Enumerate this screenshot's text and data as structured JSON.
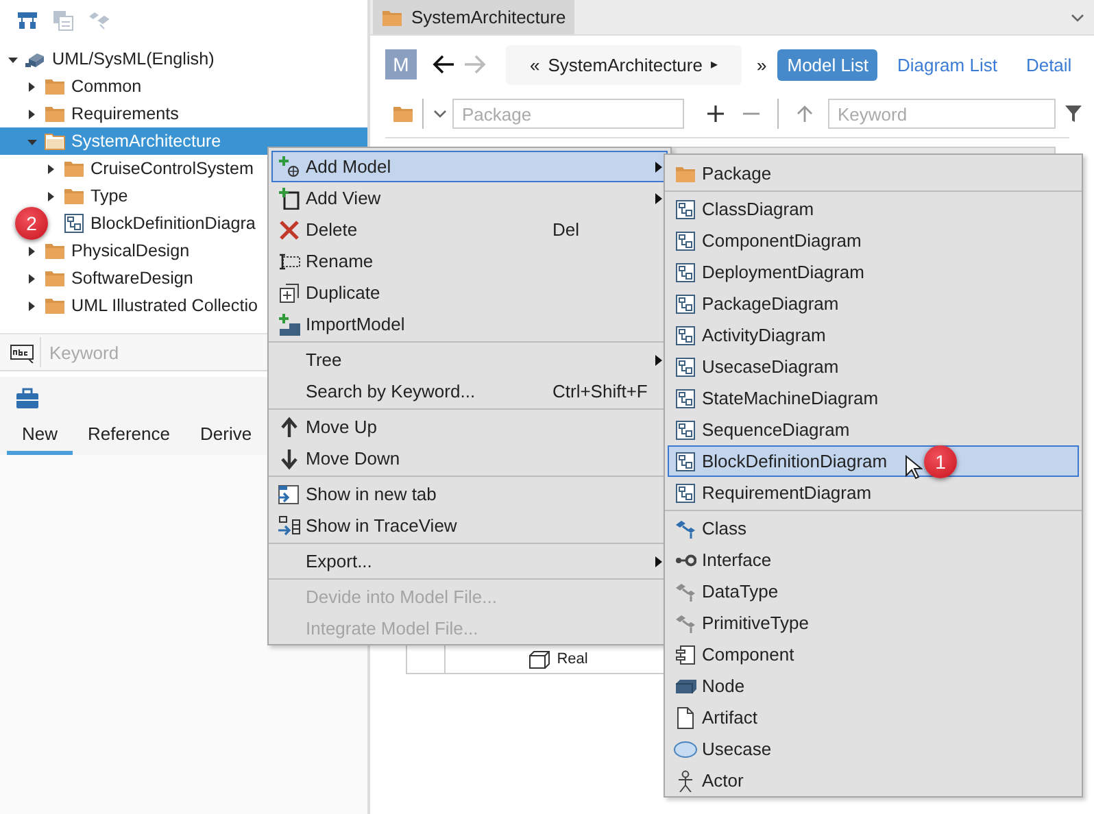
{
  "left_toolbar": [
    {
      "disabled": false
    },
    {
      "disabled": true
    },
    {
      "disabled": true
    }
  ],
  "tree": [
    {
      "label": "UML/SysML(English)",
      "kind": "model",
      "expanded": true,
      "selected": false,
      "children": [
        {
          "label": "Common",
          "kind": "package",
          "expanded": false,
          "selected": false
        },
        {
          "label": "Requirements",
          "kind": "package",
          "expanded": false,
          "selected": false
        },
        {
          "label": "SystemArchitecture",
          "kind": "package",
          "expanded": true,
          "selected": true,
          "children": [
            {
              "label": "CruiseControlSystem",
              "kind": "package",
              "expanded": false,
              "selected": false
            },
            {
              "label": "Type",
              "kind": "package",
              "expanded": false,
              "selected": false
            },
            {
              "label": "BlockDefinitionDiagra",
              "kind": "diagram",
              "selected": false,
              "badge": "2"
            }
          ]
        },
        {
          "label": "PhysicalDesign",
          "kind": "package",
          "expanded": false,
          "selected": false
        },
        {
          "label": "SoftwareDesign",
          "kind": "package",
          "expanded": false,
          "selected": false
        },
        {
          "label": "UML Illustrated Collectio",
          "kind": "package",
          "expanded": false,
          "selected": false
        }
      ]
    }
  ],
  "tree_search": {
    "placeholder": "Keyword"
  },
  "toolbox": {
    "tabs": [
      {
        "label": "New",
        "selected": true
      },
      {
        "label": "Reference",
        "selected": false
      },
      {
        "label": "Derive",
        "selected": false
      }
    ]
  },
  "editor": {
    "tab": "SystemArchitecture",
    "avatar": "M",
    "back": {
      "disabled": false
    },
    "forward": {
      "disabled": true
    },
    "breadcrumb": {
      "prev": "«",
      "label": "SystemArchitecture",
      "next": "▸"
    },
    "more": "»",
    "views": [
      {
        "label": "Model List",
        "selected": true
      },
      {
        "label": "Diagram List",
        "selected": false
      },
      {
        "label": "Detail",
        "selected": false
      }
    ],
    "package_field": {
      "placeholder": "Package"
    },
    "keyword_field": {
      "placeholder": "Keyword"
    },
    "table": {
      "rows": [
        {
          "name": "Real"
        }
      ]
    }
  },
  "context_menu": [
    {
      "kind": "item",
      "label": "Add Model",
      "submenu": true,
      "highlighted": true,
      "disabled": false
    },
    {
      "kind": "item",
      "label": "Add View",
      "submenu": true,
      "highlighted": false,
      "disabled": false
    },
    {
      "kind": "item",
      "label": "Delete",
      "shortcut": "Del",
      "submenu": false,
      "highlighted": false,
      "disabled": false
    },
    {
      "kind": "item",
      "label": "Rename",
      "submenu": false,
      "highlighted": false,
      "disabled": false
    },
    {
      "kind": "item",
      "label": "Duplicate",
      "submenu": false,
      "highlighted": false,
      "disabled": false
    },
    {
      "kind": "item",
      "label": "ImportModel",
      "submenu": false,
      "highlighted": false,
      "disabled": false
    },
    {
      "kind": "separator"
    },
    {
      "kind": "item",
      "label": "Tree",
      "submenu": true,
      "highlighted": false,
      "disabled": false
    },
    {
      "kind": "item",
      "label": "Search by Keyword...",
      "shortcut": "Ctrl+Shift+F",
      "submenu": false,
      "highlighted": false,
      "disabled": false
    },
    {
      "kind": "separator"
    },
    {
      "kind": "item",
      "label": "Move Up",
      "submenu": false,
      "highlighted": false,
      "disabled": false
    },
    {
      "kind": "item",
      "label": "Move Down",
      "submenu": false,
      "highlighted": false,
      "disabled": false
    },
    {
      "kind": "separator"
    },
    {
      "kind": "item",
      "label": "Show in new tab",
      "submenu": false,
      "highlighted": false,
      "disabled": false
    },
    {
      "kind": "item",
      "label": "Show in TraceView",
      "submenu": false,
      "highlighted": false,
      "disabled": false
    },
    {
      "kind": "separator"
    },
    {
      "kind": "item",
      "label": "Export...",
      "submenu": true,
      "highlighted": false,
      "disabled": false
    },
    {
      "kind": "separator"
    },
    {
      "kind": "item",
      "label": "Devide into Model File...",
      "submenu": false,
      "highlighted": false,
      "disabled": true
    },
    {
      "kind": "item",
      "label": "Integrate Model File...",
      "submenu": false,
      "highlighted": false,
      "disabled": true
    }
  ],
  "add_model_menu": [
    {
      "kind": "item",
      "label": "Package",
      "highlighted": false
    },
    {
      "kind": "separator"
    },
    {
      "kind": "item",
      "label": "ClassDiagram",
      "highlighted": false
    },
    {
      "kind": "item",
      "label": "ComponentDiagram",
      "highlighted": false
    },
    {
      "kind": "item",
      "label": "DeploymentDiagram",
      "highlighted": false
    },
    {
      "kind": "item",
      "label": "PackageDiagram",
      "highlighted": false
    },
    {
      "kind": "item",
      "label": "ActivityDiagram",
      "highlighted": false
    },
    {
      "kind": "item",
      "label": "UsecaseDiagram",
      "highlighted": false
    },
    {
      "kind": "item",
      "label": "StateMachineDiagram",
      "highlighted": false
    },
    {
      "kind": "item",
      "label": "SequenceDiagram",
      "highlighted": false
    },
    {
      "kind": "item",
      "label": "BlockDefinitionDiagram",
      "highlighted": true,
      "badge": "1"
    },
    {
      "kind": "item",
      "label": "RequirementDiagram",
      "highlighted": false
    },
    {
      "kind": "separator"
    },
    {
      "kind": "item",
      "label": "Class",
      "highlighted": false
    },
    {
      "kind": "item",
      "label": "Interface",
      "highlighted": false
    },
    {
      "kind": "item",
      "label": "DataType",
      "highlighted": false
    },
    {
      "kind": "item",
      "label": "PrimitiveType",
      "highlighted": false
    },
    {
      "kind": "item",
      "label": "Component",
      "highlighted": false
    },
    {
      "kind": "item",
      "label": "Node",
      "highlighted": false
    },
    {
      "kind": "item",
      "label": "Artifact",
      "highlighted": false
    },
    {
      "kind": "item",
      "label": "Usecase",
      "highlighted": false
    },
    {
      "kind": "item",
      "label": "Actor",
      "highlighted": false
    }
  ]
}
